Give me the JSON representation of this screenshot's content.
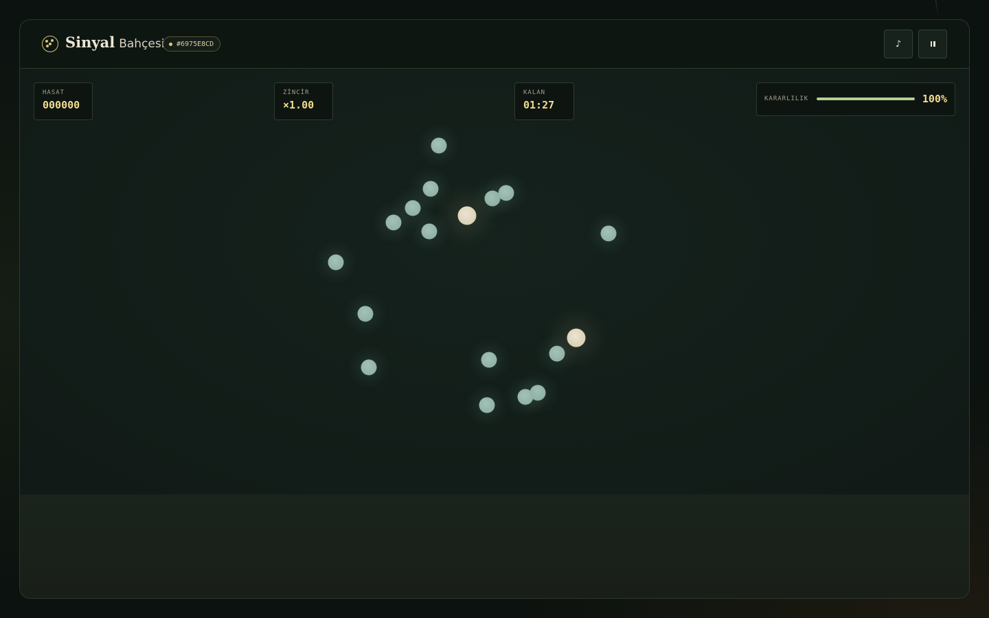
{
  "header": {
    "brand_main": "Sinyal",
    "brand_sub": "Bahçesi",
    "seed_code": "#6975E8CD",
    "music_icon": "♪",
    "pause_icon": "⏸"
  },
  "stats": {
    "harvest": {
      "label": "HASAT",
      "value": "000000"
    },
    "chain": {
      "label": "ZİNCİR",
      "value": "×1.00"
    },
    "remaining": {
      "label": "KALAN",
      "value": "01:27"
    },
    "stability": {
      "label": "KARARLILIK",
      "value_text": "100%",
      "percent": 100
    }
  },
  "colors": {
    "accent": "#f2dc8f",
    "stability_fill": "#b7cf94",
    "seed_orb": "#92b2a7",
    "bloom_orb": "#e4dcc4"
  },
  "field": {
    "seeds_count_visible": 17,
    "blooms_count_visible": 2
  }
}
